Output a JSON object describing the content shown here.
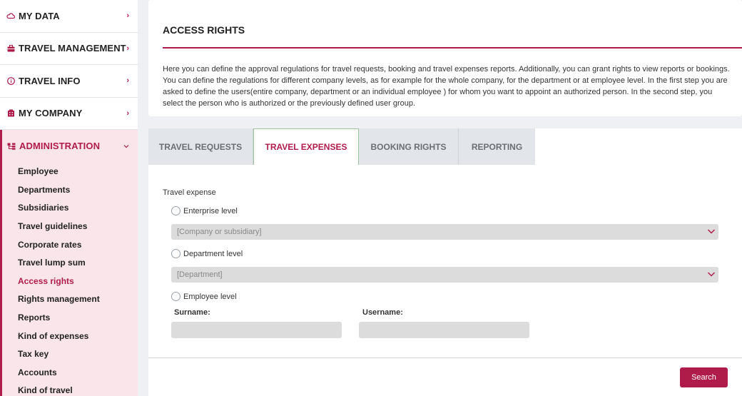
{
  "sidebar": {
    "items": [
      {
        "label": "MY DATA",
        "icon": "cloud-icon"
      },
      {
        "label": "TRAVEL MANAGEMENT",
        "icon": "briefcase-icon"
      },
      {
        "label": "TRAVEL INFO",
        "icon": "info-icon"
      },
      {
        "label": "MY COMPANY",
        "icon": "building-icon"
      }
    ],
    "admin": {
      "label": "ADMINISTRATION",
      "icon": "hierarchy-icon",
      "subitems": [
        "Employee",
        "Departments",
        "Subsidiaries",
        "Travel guidelines",
        "Corporate rates",
        "Travel lump sum",
        "Access rights",
        "Rights management",
        "Reports",
        "Kind of expenses",
        "Tax key",
        "Accounts",
        "Kind of travel"
      ],
      "active_subitem": "Access rights"
    }
  },
  "info": {
    "title": "ACCESS RIGHTS",
    "description": "Here you can define the approval regulations for travel requests, booking and travel expenses reports. Additionally, you can grant rights to view reports or bookings. You can define the regulations for different company levels, as for example for the whole company, for the department or at employee level. In the first step you are asked to define the users(entire company, department or an individual employee ) for whom you want to appoint an authorized person. In the second step, you select the person who is authorized or the previously defined user group."
  },
  "tabs": [
    {
      "label": "TRAVEL REQUESTS",
      "active": false
    },
    {
      "label": "TRAVEL EXPENSES",
      "active": true
    },
    {
      "label": "BOOKING RIGHTS",
      "active": false
    },
    {
      "label": "REPORTING",
      "active": false
    }
  ],
  "form": {
    "section_label": "Travel expense",
    "enterprise_label": "Enterprise level",
    "company_placeholder": "[Company or subsidiary]",
    "department_label": "Department level",
    "department_placeholder": "[Department]",
    "employee_label": "Employee level",
    "surname_label": "Surname:",
    "username_label": "Username:",
    "surname_value": "",
    "username_value": ""
  },
  "footer": {
    "search_label": "Search"
  },
  "colors": {
    "accent": "#b01c4a",
    "admin_bg": "#f9e5ea",
    "field_bg": "#dcdcdc"
  }
}
